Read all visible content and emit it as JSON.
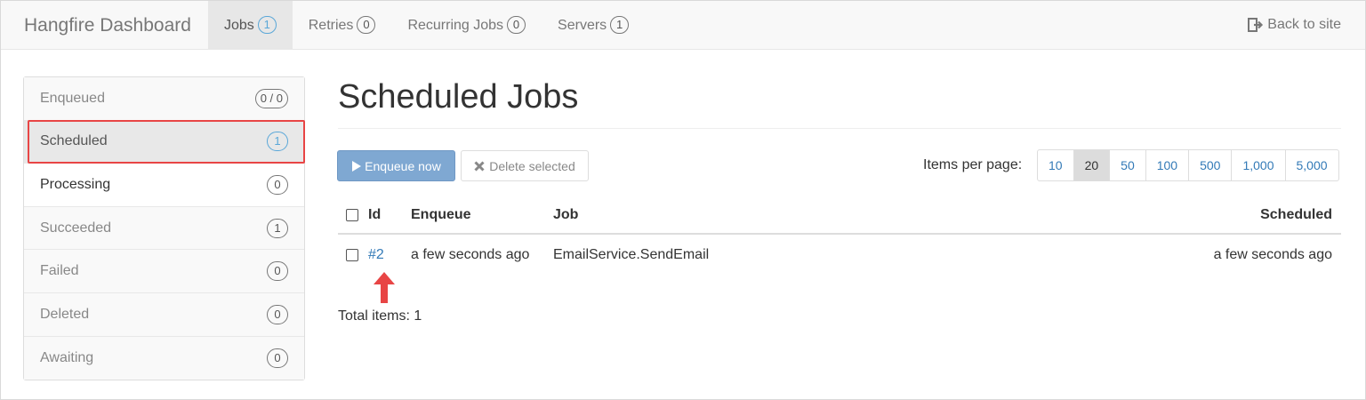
{
  "navbar": {
    "brand": "Hangfire Dashboard",
    "items": [
      {
        "label": "Jobs",
        "count": "1",
        "active": true
      },
      {
        "label": "Retries",
        "count": "0"
      },
      {
        "label": "Recurring Jobs",
        "count": "0"
      },
      {
        "label": "Servers",
        "count": "1"
      }
    ],
    "back_label": "Back to site"
  },
  "sidebar": {
    "items": [
      {
        "label": "Enqueued",
        "count": "0 / 0"
      },
      {
        "label": "Scheduled",
        "count": "1",
        "active": true
      },
      {
        "label": "Processing",
        "count": "0"
      },
      {
        "label": "Succeeded",
        "count": "1"
      },
      {
        "label": "Failed",
        "count": "0"
      },
      {
        "label": "Deleted",
        "count": "0"
      },
      {
        "label": "Awaiting",
        "count": "0"
      }
    ]
  },
  "main": {
    "title": "Scheduled Jobs",
    "enqueue_button": "Enqueue now",
    "delete_button": "Delete selected",
    "items_per_page_label": "Items per page:",
    "page_sizes": [
      "10",
      "20",
      "50",
      "100",
      "500",
      "1,000",
      "5,000"
    ],
    "selected_page_size": "20",
    "table": {
      "headers": {
        "id": "Id",
        "enqueue": "Enqueue",
        "job": "Job",
        "scheduled": "Scheduled"
      },
      "rows": [
        {
          "id": "#2",
          "enqueue": "a few seconds ago",
          "job": "EmailService.SendEmail",
          "scheduled": "a few seconds ago"
        }
      ]
    },
    "total_items": "Total items: 1"
  },
  "colors": {
    "accent": "#337ab7",
    "annotation": "#e84545",
    "badge_active": "#5aa7d8"
  }
}
